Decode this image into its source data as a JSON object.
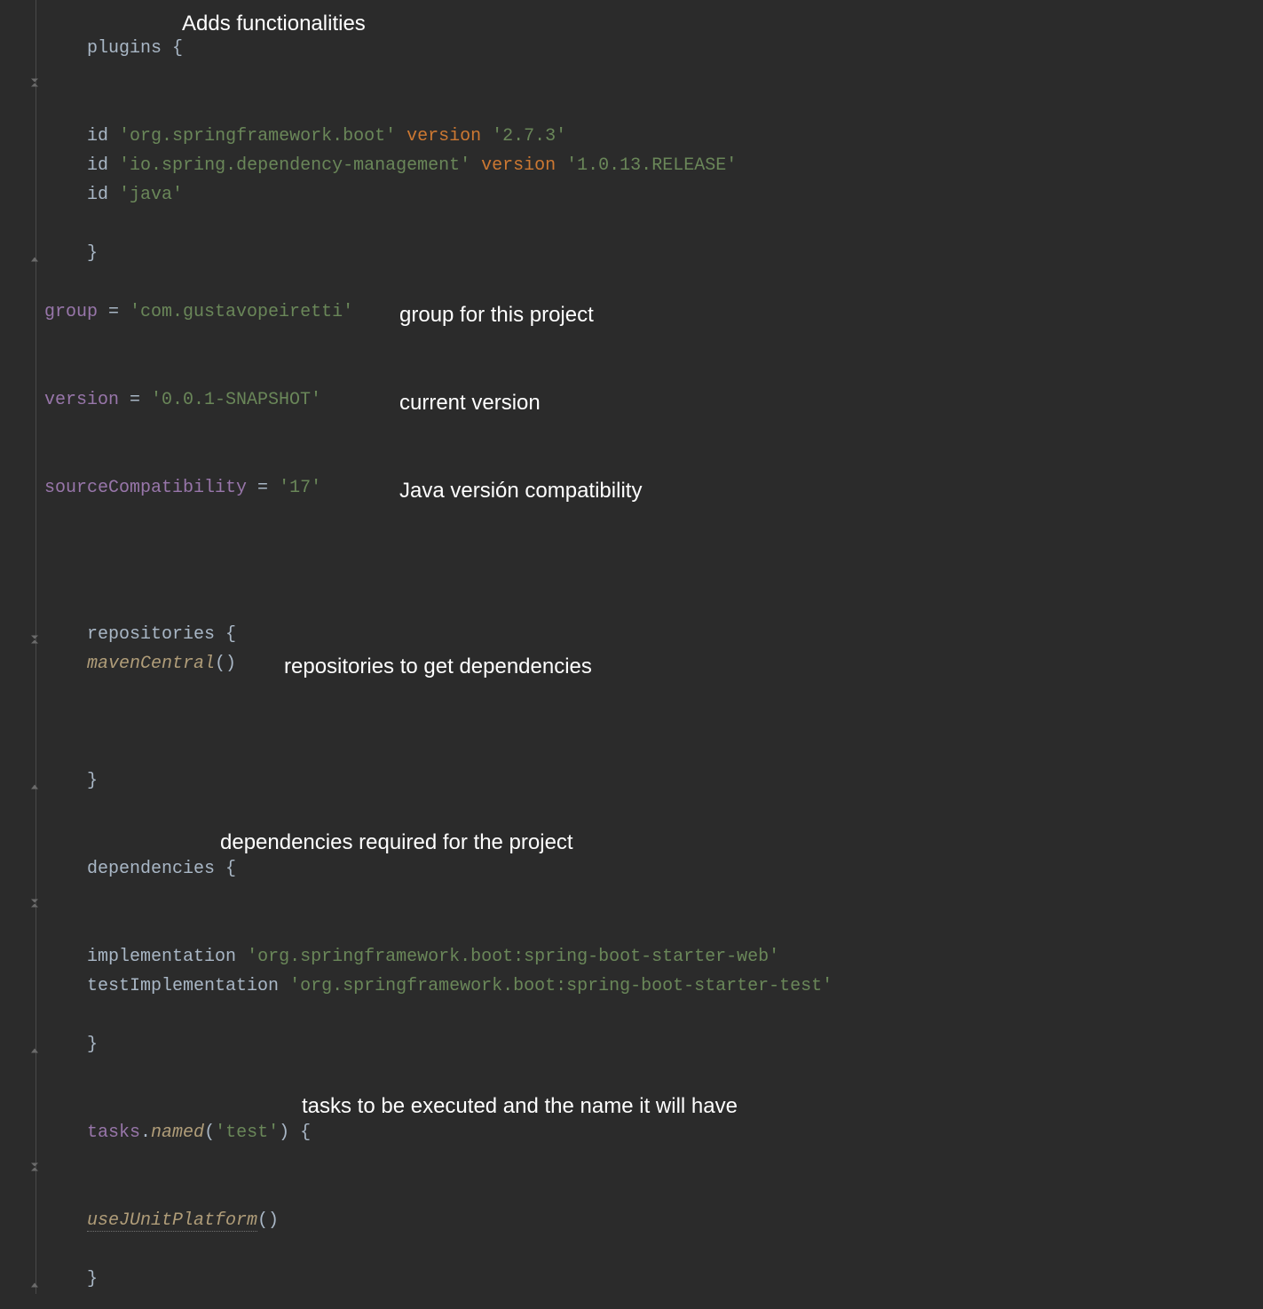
{
  "code": {
    "plugins_kw": "plugins",
    "open_brace": " {",
    "close_brace": "}",
    "id_kw": "id",
    "plugin1_id": "'org.springframework.boot'",
    "version_kw": "version",
    "plugin1_ver": "'2.7.3'",
    "plugin2_id": "'io.spring.dependency-management'",
    "plugin2_ver": "'1.0.13.RELEASE'",
    "plugin3_id": "'java'",
    "group_kw": "group",
    "eq": " = ",
    "group_val": "'com.gustavopeiretti'",
    "version_prop": "version",
    "version_val": "'0.0.1-SNAPSHOT'",
    "source_kw": "sourceCompatibility",
    "source_val": "'17'",
    "repos_kw": "repositories",
    "maven": "mavenCentral",
    "parens": "()",
    "deps_kw": "dependencies",
    "impl": "implementation",
    "dep1": "'org.springframework.boot:spring-boot-starter-web'",
    "testImpl": "testImplementation",
    "dep2": "'org.springframework.boot:spring-boot-starter-test'",
    "tasks": "tasks",
    "dot": ".",
    "named": "named",
    "lparen": "(",
    "test_str": "'test'",
    "rparen": ")",
    "junit": "useJUnitPlatform"
  },
  "annotations": {
    "plugins": "Adds functionalities",
    "group": "group for this project",
    "version": "current version",
    "source": "Java versión compatibility",
    "repos": "repositories to get dependencies",
    "deps": "dependencies required for the project",
    "tasks": "tasks to be executed and the name it will have"
  }
}
